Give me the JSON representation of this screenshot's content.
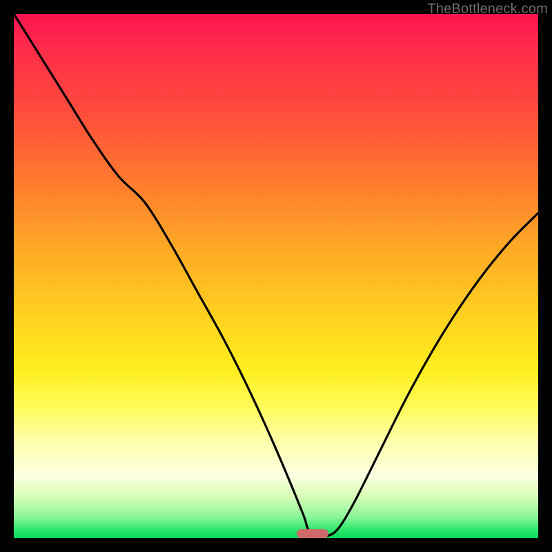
{
  "watermark": "TheBottleneck.com",
  "colors": {
    "frame": "#000000",
    "curve_stroke": "#000000",
    "marker": "#cf6a6a",
    "watermark_text": "#6d6d6d"
  },
  "chart_data": {
    "type": "line",
    "title": "",
    "xlabel": "",
    "ylabel": "",
    "xlim": [
      0,
      100
    ],
    "ylim": [
      0,
      100
    ],
    "grid": false,
    "legend": false,
    "x": [
      0,
      5,
      10,
      15,
      20,
      25,
      30,
      35,
      40,
      45,
      50,
      55,
      56,
      57,
      58,
      60,
      62,
      65,
      70,
      75,
      80,
      85,
      90,
      95,
      100
    ],
    "values": [
      100,
      92,
      84,
      76,
      69,
      64,
      56,
      47,
      38,
      28,
      17,
      5,
      2,
      0.5,
      0.5,
      0.5,
      2,
      7,
      17,
      27,
      36,
      44,
      51,
      57,
      62
    ],
    "minimum_position_x": 57,
    "marker": {
      "x_center": 57,
      "width_x": 6,
      "y": 0
    },
    "background_gradient_stops": [
      {
        "pos": 0,
        "color": "#ff1450"
      },
      {
        "pos": 0.18,
        "color": "#ff4a3d"
      },
      {
        "pos": 0.44,
        "color": "#ffa726"
      },
      {
        "pos": 0.68,
        "color": "#ffef1f"
      },
      {
        "pos": 0.88,
        "color": "#fcffe0"
      },
      {
        "pos": 1.0,
        "color": "#0cd85e"
      }
    ]
  }
}
